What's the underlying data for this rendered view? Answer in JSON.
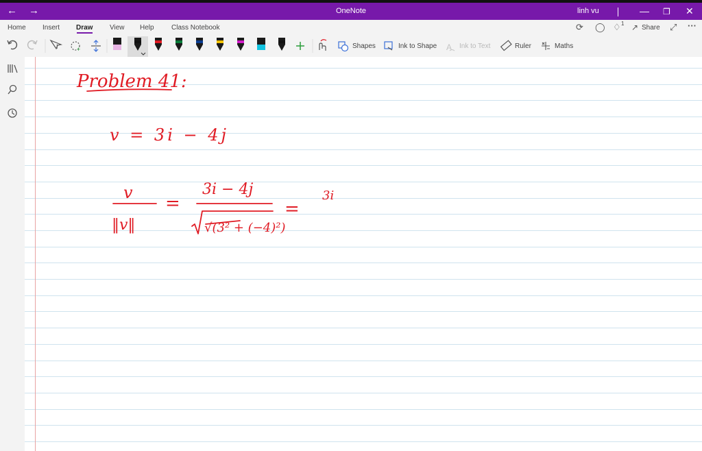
{
  "app": {
    "title": "OneNote",
    "user": "linh vu",
    "back_icon": "arrow-left-icon",
    "forward_icon": "arrow-right-icon",
    "accent": "#7719aa"
  },
  "ribbon": {
    "tabs": [
      "Home",
      "Insert",
      "Draw",
      "View",
      "Help",
      "Class Notebook"
    ],
    "active_tab": "Draw",
    "share_label": "Share",
    "shapes_label": "Shapes",
    "ink_to_shape_label": "Ink to Shape",
    "ink_to_text_label": "Ink to Text",
    "ruler_label": "Ruler",
    "maths_label": "Maths",
    "notification_count": "1",
    "pens": [
      {
        "name": "pink-highlighter",
        "color": "#e8b4e4"
      },
      {
        "name": "black-pen-selected",
        "color": "#111111"
      },
      {
        "name": "red-pen",
        "color": "#e01b24"
      },
      {
        "name": "green-pen",
        "color": "#0a7d3a"
      },
      {
        "name": "blue-pen",
        "color": "#0b3d91"
      },
      {
        "name": "yellow-pen",
        "color": "#f2c200"
      },
      {
        "name": "magenta-pen",
        "color": "#d11bc8"
      },
      {
        "name": "cyan-highlighter",
        "color": "#12c3e0"
      },
      {
        "name": "black-pen",
        "color": "#111111"
      }
    ]
  },
  "ink": {
    "color": "#e01b24",
    "text": [
      "Problem 41:",
      "v = 3i − 4j",
      "v",
      "‖v‖",
      "=",
      "3i − 4j",
      "√(3² + (−4)²)",
      "=",
      "3i"
    ]
  }
}
